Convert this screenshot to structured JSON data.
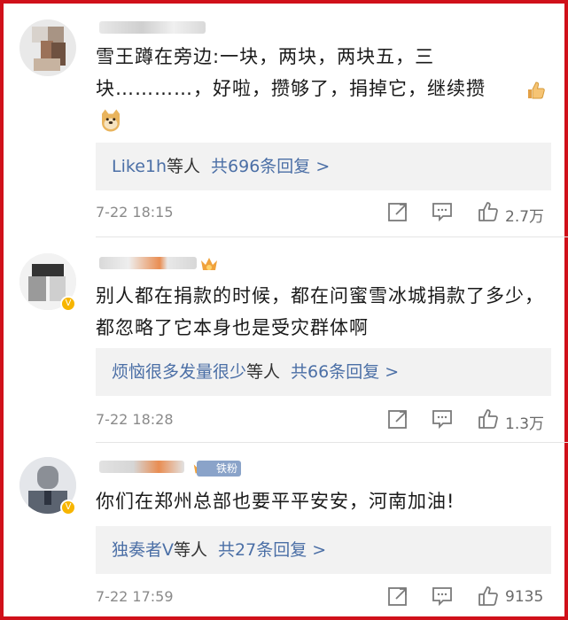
{
  "comments": [
    {
      "text": "雪王蹲在旁边:一块，两块，两块五，三块…………，好啦，攒够了，捐掉它，继续攒",
      "reply_users": "Like1h",
      "reply_deng": "等人",
      "reply_count": "共696条回复 >",
      "time": "7-22 18:15",
      "likes": "2.7万"
    },
    {
      "text": "别人都在捐款的时候，都在问蜜雪冰城捐款了多少，都忽略了它本身也是受灾群体啊",
      "reply_users": "烦恼很多发量很少",
      "reply_deng": "等人",
      "reply_count": "共66条回复 >",
      "time": "7-22 18:28",
      "likes": "1.3万"
    },
    {
      "text": "你们在郑州总部也要平平安安，河南加油!",
      "fan_badge": "铁粉",
      "reply_users": "独奏者Ⅴ",
      "reply_deng": "等人",
      "reply_count": "共27条回复 >",
      "time": "7-22 17:59",
      "likes": "9135"
    }
  ],
  "icons": {
    "share": "share-icon",
    "comment": "comment-icon",
    "like": "thumbs-up-icon",
    "verified": "verified-v-icon",
    "crown": "crown-icon",
    "emoji_thumb": "thumbs-up-emoji",
    "emoji_doge": "doge-emoji"
  },
  "colors": {
    "link": "#4b6fa6",
    "frame": "#d0101a",
    "reply_bg": "#f2f2f2"
  }
}
